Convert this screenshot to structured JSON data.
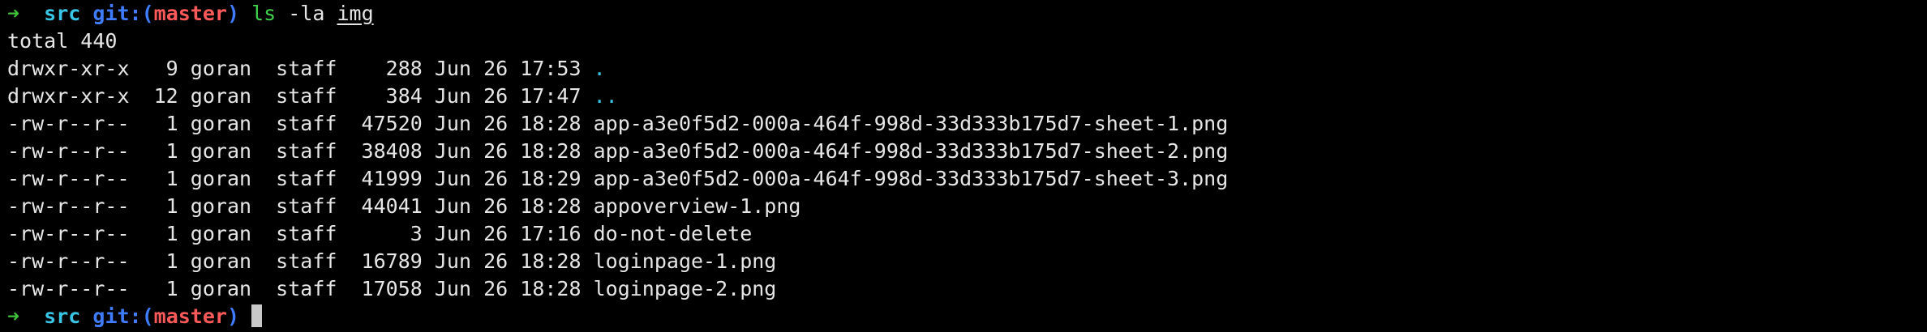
{
  "prompt": {
    "arrow": "➜",
    "dir": "src",
    "git_label": "git:(",
    "branch": "master",
    "git_close": ")"
  },
  "command": {
    "name": "ls",
    "flags": "-la",
    "target": "img"
  },
  "total_line": "total 440",
  "entries": [
    {
      "perms": "drwxr-xr-x",
      "links": "9",
      "owner": "goran",
      "group": "staff",
      "size": "288",
      "month": "Jun",
      "day": "26",
      "time": "17:53",
      "name": "."
    },
    {
      "perms": "drwxr-xr-x",
      "links": "12",
      "owner": "goran",
      "group": "staff",
      "size": "384",
      "month": "Jun",
      "day": "26",
      "time": "17:47",
      "name": ".."
    },
    {
      "perms": "-rw-r--r--",
      "links": "1",
      "owner": "goran",
      "group": "staff",
      "size": "47520",
      "month": "Jun",
      "day": "26",
      "time": "18:28",
      "name": "app-a3e0f5d2-000a-464f-998d-33d333b175d7-sheet-1.png"
    },
    {
      "perms": "-rw-r--r--",
      "links": "1",
      "owner": "goran",
      "group": "staff",
      "size": "38408",
      "month": "Jun",
      "day": "26",
      "time": "18:28",
      "name": "app-a3e0f5d2-000a-464f-998d-33d333b175d7-sheet-2.png"
    },
    {
      "perms": "-rw-r--r--",
      "links": "1",
      "owner": "goran",
      "group": "staff",
      "size": "41999",
      "month": "Jun",
      "day": "26",
      "time": "18:29",
      "name": "app-a3e0f5d2-000a-464f-998d-33d333b175d7-sheet-3.png"
    },
    {
      "perms": "-rw-r--r--",
      "links": "1",
      "owner": "goran",
      "group": "staff",
      "size": "44041",
      "month": "Jun",
      "day": "26",
      "time": "18:28",
      "name": "appoverview-1.png"
    },
    {
      "perms": "-rw-r--r--",
      "links": "1",
      "owner": "goran",
      "group": "staff",
      "size": "3",
      "month": "Jun",
      "day": "26",
      "time": "17:16",
      "name": "do-not-delete"
    },
    {
      "perms": "-rw-r--r--",
      "links": "1",
      "owner": "goran",
      "group": "staff",
      "size": "16789",
      "month": "Jun",
      "day": "26",
      "time": "18:28",
      "name": "loginpage-1.png"
    },
    {
      "perms": "-rw-r--r--",
      "links": "1",
      "owner": "goran",
      "group": "staff",
      "size": "17058",
      "month": "Jun",
      "day": "26",
      "time": "18:28",
      "name": "loginpage-2.png"
    }
  ],
  "colors": {
    "background": "#000000",
    "text": "#e6e6e6",
    "arrow": "#3fc23a",
    "dir": "#38c6e6",
    "git": "#3f7cff",
    "branch": "#ff5a5a",
    "command": "#3fd24a",
    "cursor": "#c8c8c8"
  }
}
